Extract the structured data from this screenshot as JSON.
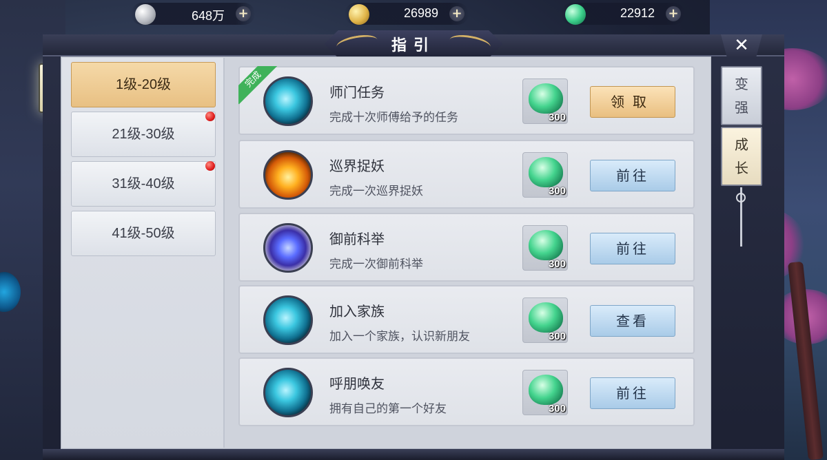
{
  "currencies": [
    {
      "icon": "silver-coin-icon",
      "value": "648万",
      "plus": "+"
    },
    {
      "icon": "gold-coin-icon",
      "value": "26989",
      "plus": "+"
    },
    {
      "icon": "jade-icon",
      "value": "22912",
      "plus": "+"
    }
  ],
  "window": {
    "title": "指引",
    "close": "✕"
  },
  "level_tabs": [
    {
      "label": "1级-20级",
      "active": true,
      "has_dot": false
    },
    {
      "label": "21级-30级",
      "active": false,
      "has_dot": true
    },
    {
      "label": "31级-40级",
      "active": false,
      "has_dot": true
    },
    {
      "label": "41级-50级",
      "active": false,
      "has_dot": false
    }
  ],
  "tasks": [
    {
      "title": "师门任务",
      "desc": "完成十次师傅给予的任务",
      "icon": "swirl-icon",
      "reward": "300",
      "button": "领取",
      "button_style": "gold",
      "badge": "完成"
    },
    {
      "title": "巡界捉妖",
      "desc": "完成一次巡界捉妖",
      "icon": "fire-icon",
      "reward": "300",
      "button": "前往",
      "button_style": "blue",
      "badge": ""
    },
    {
      "title": "御前科举",
      "desc": "完成一次御前科举",
      "icon": "gem-icon",
      "reward": "300",
      "button": "前往",
      "button_style": "blue",
      "badge": ""
    },
    {
      "title": "加入家族",
      "desc": "加入一个家族，认识新朋友",
      "icon": "swirl-icon",
      "reward": "300",
      "button": "查看",
      "button_style": "blue",
      "badge": ""
    },
    {
      "title": "呼朋唤友",
      "desc": "拥有自己的第一个好友",
      "icon": "swirl-icon",
      "reward": "300",
      "button": "前往",
      "button_style": "blue",
      "badge": ""
    }
  ],
  "side_tabs": [
    {
      "line1": "变",
      "line2": "强",
      "active": false
    },
    {
      "line1": "成",
      "line2": "长",
      "active": true
    }
  ],
  "colors": {
    "active_tab": "#e8c083",
    "button_blue": "#a9cbe8",
    "button_gold": "#e9bf80",
    "done_badge": "#3fb25a",
    "red_dot": "#e01d1d"
  }
}
